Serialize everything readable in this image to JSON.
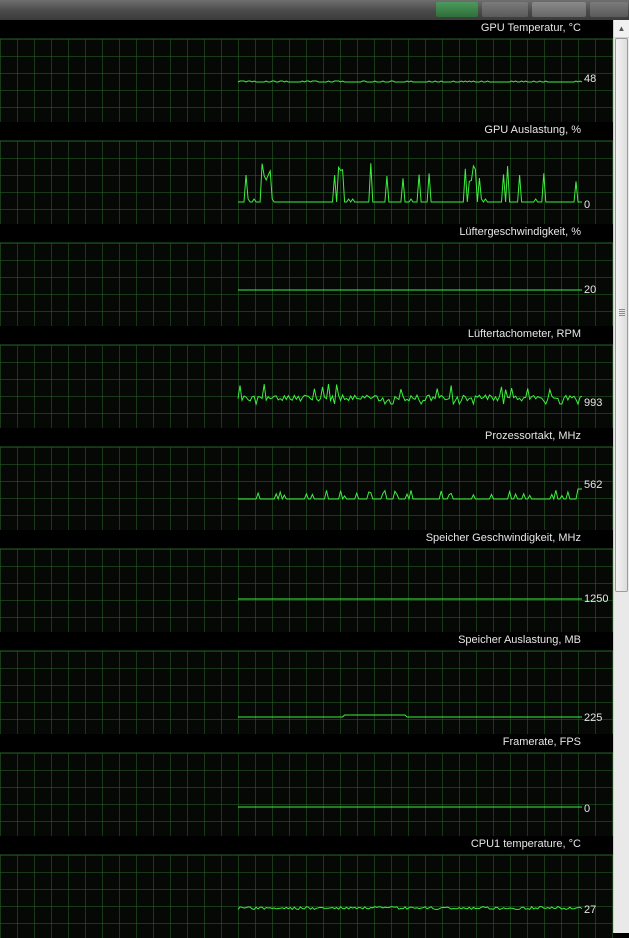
{
  "colors": {
    "line": "#3df03d",
    "grid": "#285f28",
    "text": "#e6e6e6",
    "background": "#000000"
  },
  "panels": [
    {
      "title": "GPU Temperatur, °C",
      "value": "48",
      "series": [
        48,
        48,
        48,
        48,
        48,
        48,
        48,
        48,
        48,
        48,
        48,
        48,
        48,
        48,
        48,
        48,
        48,
        48,
        48,
        48,
        48,
        48,
        48,
        48,
        48,
        48,
        48,
        48,
        48,
        48,
        48,
        48,
        48,
        48,
        48,
        48,
        48,
        48,
        48,
        48,
        48,
        48,
        48,
        48,
        48,
        48,
        48,
        48,
        48,
        48,
        48,
        48,
        48,
        48,
        48,
        48,
        48,
        48,
        48,
        48,
        48,
        48,
        48,
        48,
        48,
        48,
        48,
        48,
        48,
        48,
        48,
        48,
        48,
        48,
        48,
        48,
        48,
        48,
        48,
        48,
        48,
        48,
        48,
        48,
        48,
        48,
        48,
        48,
        48,
        48,
        48,
        48,
        48,
        48,
        48,
        48,
        48,
        48,
        48,
        48,
        48,
        48,
        48,
        48,
        48,
        48,
        48,
        48,
        48,
        48,
        48,
        48,
        48,
        48,
        48,
        48,
        48,
        48,
        48,
        48,
        48,
        48,
        48,
        48,
        48,
        48,
        48,
        48,
        48,
        48,
        48,
        48,
        48,
        48,
        48,
        48,
        48,
        48,
        48,
        48,
        48,
        48,
        48,
        48,
        48,
        48,
        48,
        48,
        48,
        48,
        48,
        48,
        48,
        48,
        48,
        48,
        48,
        48,
        48,
        48,
        48,
        48,
        48,
        48,
        48,
        48,
        48,
        48,
        48,
        48,
        48,
        48,
        48,
        48,
        48,
        48,
        48,
        48,
        48,
        48,
        48,
        48,
        48,
        48,
        48,
        48,
        48,
        48,
        48,
        48,
        48,
        48,
        48,
        48,
        48,
        48,
        48,
        48,
        48,
        48,
        48,
        48,
        48,
        48,
        48,
        48,
        48,
        48,
        48,
        48,
        48,
        48,
        48,
        48,
        48,
        48,
        48,
        48,
        48,
        48,
        48,
        48,
        48,
        48,
        48,
        48,
        48,
        48,
        48,
        48,
        48,
        48,
        48,
        48,
        48,
        48,
        48,
        48,
        48,
        48,
        48,
        48,
        48,
        48,
        48,
        48,
        48,
        48,
        48,
        48,
        48,
        48,
        48,
        48,
        48,
        48,
        48,
        48,
        48,
        48,
        48,
        48,
        48,
        48,
        48,
        48,
        48,
        48,
        48,
        48,
        48,
        48,
        48,
        48,
        48,
        48,
        48,
        48,
        48,
        48,
        48,
        48,
        48,
        48,
        48,
        48,
        48,
        48,
        48,
        48,
        48,
        48,
        48,
        48,
        48,
        48,
        48,
        48,
        48,
        48,
        48,
        48,
        48,
        48,
        48,
        48,
        48,
        48,
        48,
        48,
        48,
        48,
        48,
        48,
        48,
        48,
        48,
        48,
        48,
        48,
        48,
        48,
        48,
        48,
        48,
        48,
        48,
        48,
        48,
        48,
        48,
        48,
        48,
        48,
        48,
        48,
        48
      ]
    },
    {
      "title": "GPU Auslastung, %",
      "value": "0",
      "series": []
    },
    {
      "title": "Lüftergeschwindigkeit, %",
      "value": "20",
      "series": []
    },
    {
      "title": "Lüftertachometer, RPM",
      "value": "993",
      "series": []
    },
    {
      "title": "Prozessortakt, MHz",
      "value": "562",
      "series": []
    },
    {
      "title": "Speicher Geschwindigkeit, MHz",
      "value": "1250",
      "series": []
    },
    {
      "title": "Speicher Auslastung, MB",
      "value": "225",
      "series": []
    },
    {
      "title": "Framerate, FPS",
      "value": "0",
      "series": []
    },
    {
      "title": "CPU1 temperature, °C",
      "value": "27",
      "series": []
    }
  ]
}
